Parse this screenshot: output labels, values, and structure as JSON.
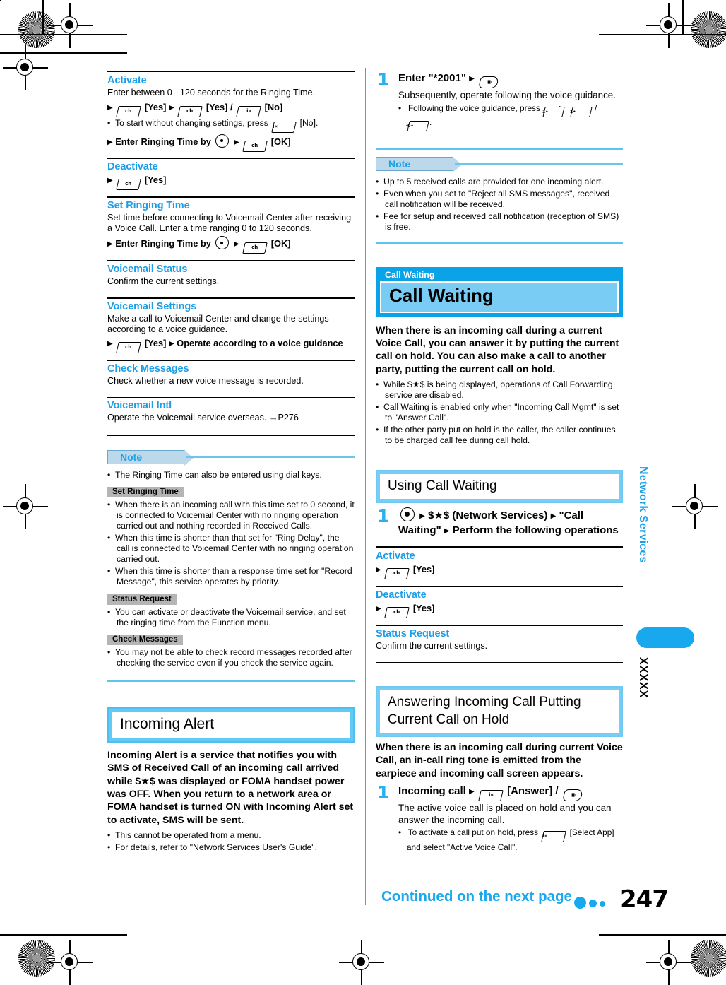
{
  "page": {
    "number": "247",
    "continued": "Continued on the next page",
    "side_tab_title": "Network Services",
    "side_tab_code": "XXXXX"
  },
  "icons": {
    "arrow": "right-triangle-arrow",
    "soft_ch": "ch",
    "soft_i": "i«",
    "key_call": "©",
    "key_1": "1",
    "key_0": "0",
    "nav_key": "nav-key",
    "center_key": "center-key"
  },
  "left_column": {
    "activate": {
      "title": "Activate",
      "desc": "Enter between 0 - 120 seconds for the Ringing Time.",
      "op1_yes1": "[Yes]",
      "op1_yes2": "[Yes] /",
      "op1_no": "[No]",
      "bullet": "To start without changing settings, press",
      "bullet_tail": "[No].",
      "op2_pre": "Enter Ringing Time by",
      "op2_ok": "[OK]"
    },
    "deactivate": {
      "title": "Deactivate",
      "yes": "[Yes]"
    },
    "set_ringing_time": {
      "title": "Set Ringing Time",
      "desc": "Set time before connecting to Voicemail Center after receiving a Voice Call. Enter a time ranging 0 to 120 seconds.",
      "op_pre": "Enter Ringing Time by",
      "op_ok": "[OK]"
    },
    "voicemail_status": {
      "title": "Voicemail Status",
      "desc": "Confirm the current settings."
    },
    "voicemail_settings": {
      "title": "Voicemail Settings",
      "desc": "Make a call to Voicemail Center and change the settings according to a voice guidance.",
      "op_yes": "[Yes]",
      "op_tail": "Operate according to a voice guidance"
    },
    "check_messages": {
      "title": "Check Messages",
      "desc": "Check whether a new voice message is recorded."
    },
    "voicemail_intl": {
      "title": "Voicemail Intl",
      "desc": "Operate the Voicemail service overseas. →P276"
    },
    "note": {
      "label": "Note",
      "bullets": [
        "The Ringing Time can also be entered using dial keys."
      ],
      "groups": [
        {
          "tag": "Set Ringing Time",
          "bullets": [
            "When there is an incoming call with this time set to 0 second, it is connected to Voicemail Center with no ringing operation carried out and nothing recorded in Received Calls.",
            "When this time is shorter than that set for \"Ring Delay\", the call is connected to Voicemail Center with no ringing operation carried out.",
            "When this time is shorter than a response time set for \"Record Message\", this service operates by priority."
          ]
        },
        {
          "tag": "Status Request",
          "bullets": [
            "You can activate or deactivate the Voicemail service, and set the ringing time from the Function menu."
          ]
        },
        {
          "tag": "Check Messages",
          "bullets": [
            "You may not be able to check record messages recorded after checking the service even if you check the service again."
          ]
        }
      ]
    },
    "incoming_alert": {
      "header": "Incoming Alert",
      "lead": "Incoming Alert is a service that notifies you with SMS of Received Call of an incoming call arrived while $★$ was displayed or FOMA handset power was OFF. When you return to a network area or FOMA handset is turned ON with Incoming Alert set to activate, SMS will be sent.",
      "bullets": [
        "This cannot be operated from a menu.",
        "For details, refer to \"Network Services User's Guide\"."
      ]
    }
  },
  "right_column": {
    "step_enter": {
      "num": "1",
      "head": "Enter \"*2001\"",
      "desc": "Subsequently, operate following the voice guidance.",
      "bullet_pre": "Following the voice guidance, press",
      "bullet_tail": "."
    },
    "note": {
      "label": "Note",
      "bullets": [
        "Up to 5 received calls are provided for one incoming alert.",
        "Even when you set to \"Reject all SMS messages\", received call notification will be received.",
        "Fee for setup and received call notification (reception of SMS) is free."
      ]
    },
    "call_waiting": {
      "caption": "Call Waiting",
      "title": "Call Waiting",
      "lead": "When there is an incoming call during a current Voice Call, you can answer it by putting the current call on hold. You can also make a call to another party, putting the current call on hold.",
      "bullets": [
        "While $★$ is being displayed, operations of Call Forwarding service are disabled.",
        "Call Waiting is enabled only when \"Incoming Call Mgmt\" is set to \"Answer Call\".",
        "If the other party put on hold is the caller, the caller continues to be charged call fee during call hold."
      ]
    },
    "using_call_waiting": {
      "header": "Using Call Waiting",
      "step_num": "1",
      "step_text_1": "$★$ (Network Services)",
      "step_text_2": "\"Call Waiting\"",
      "step_text_3": "Perform the following operations",
      "activate": {
        "title": "Activate",
        "yes": "[Yes]"
      },
      "deactivate": {
        "title": "Deactivate",
        "yes": "[Yes]"
      },
      "status_request": {
        "title": "Status Request",
        "desc": "Confirm the current settings."
      }
    },
    "answering": {
      "header_line1": "Answering Incoming Call Putting",
      "header_line2": "Current Call on Hold",
      "lead": "When there is an incoming call during current Voice Call, an in-call ring tone is emitted from the earpiece and incoming call screen appears.",
      "step_num": "1",
      "step_head_pre": "Incoming call",
      "step_head_answer": "[Answer] /",
      "step_desc": "The active voice call is placed on hold and you can answer the incoming call.",
      "step_bullet_pre": "To activate a call put on hold, press",
      "step_bullet_mid": "[Select App]",
      "step_bullet_tail": "and select \"Active Voice Call\"."
    }
  },
  "colors": {
    "accent_blue": "#18a8ee",
    "light_blue": "#79cdf4",
    "header_blue": "#0aa3e8",
    "note_tag": "#bcd9ec",
    "gray_tag": "#b5b5b5"
  }
}
